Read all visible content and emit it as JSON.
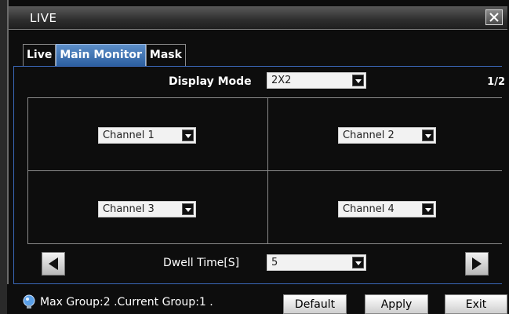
{
  "window": {
    "title": "LIVE"
  },
  "tabs": [
    {
      "label": "Live",
      "active": false
    },
    {
      "label": "Main Monitor",
      "active": true
    },
    {
      "label": "Mask",
      "active": false
    }
  ],
  "display_mode": {
    "label": "Display Mode",
    "value": "2X2"
  },
  "page_indicator": "1/2",
  "channels": [
    "Channel 1",
    "Channel 2",
    "Channel 3",
    "Channel 4"
  ],
  "dwell": {
    "label": "Dwell Time[S]",
    "value": "5"
  },
  "status": {
    "text": "Max Group:2 .Current Group:1 ."
  },
  "buttons": {
    "default": "Default",
    "apply": "Apply",
    "exit": "Exit"
  },
  "colors": {
    "accent": "#3a67b8",
    "tab_active": "#2c5fa0"
  }
}
